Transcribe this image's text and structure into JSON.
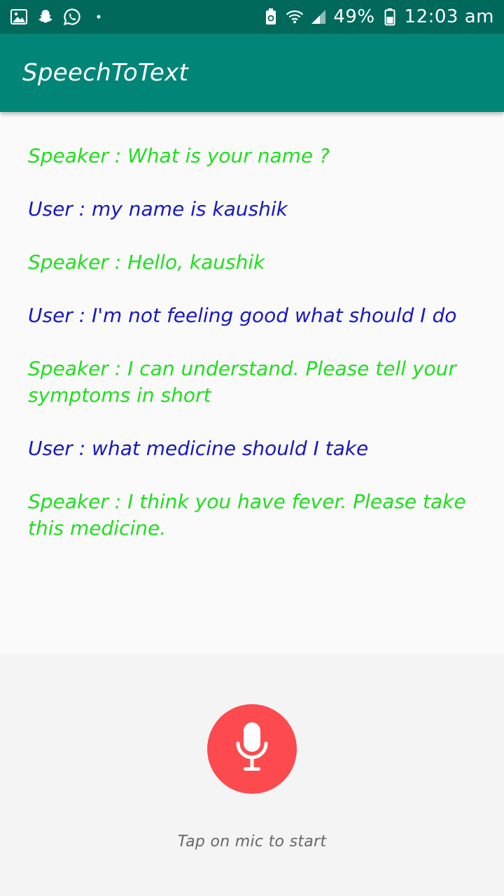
{
  "status_bar": {
    "icons_left": [
      "gallery-icon",
      "snapchat-icon",
      "whatsapp-icon",
      "notification-dot-icon"
    ],
    "icons_right": [
      "data-saver-icon",
      "wifi-icon",
      "signal-icon",
      "battery-icon"
    ],
    "battery_percent": "49%",
    "time": "12:03 am"
  },
  "app_bar": {
    "title": "SpeechToText"
  },
  "conversation": [
    {
      "role": "speaker",
      "text": "Speaker : What is your name ?"
    },
    {
      "role": "user",
      "text": "User : my name is kaushik"
    },
    {
      "role": "speaker",
      "text": "Speaker : Hello, kaushik"
    },
    {
      "role": "user",
      "text": "User : I'm not feeling good what should I do"
    },
    {
      "role": "speaker",
      "text": "Speaker : I can understand. Please tell your symptoms in short"
    },
    {
      "role": "user",
      "text": "User : what medicine should I take"
    },
    {
      "role": "speaker",
      "text": "Speaker : I think you have fever. Please take this medicine."
    }
  ],
  "mic": {
    "icon": "microphone-icon",
    "hint": "Tap on mic to start"
  },
  "colors": {
    "status_bar": "#00695c",
    "app_bar": "#008577",
    "speaker_text": "#1ee01e",
    "user_text": "#1717c4",
    "mic_button": "#fc4a4f"
  }
}
